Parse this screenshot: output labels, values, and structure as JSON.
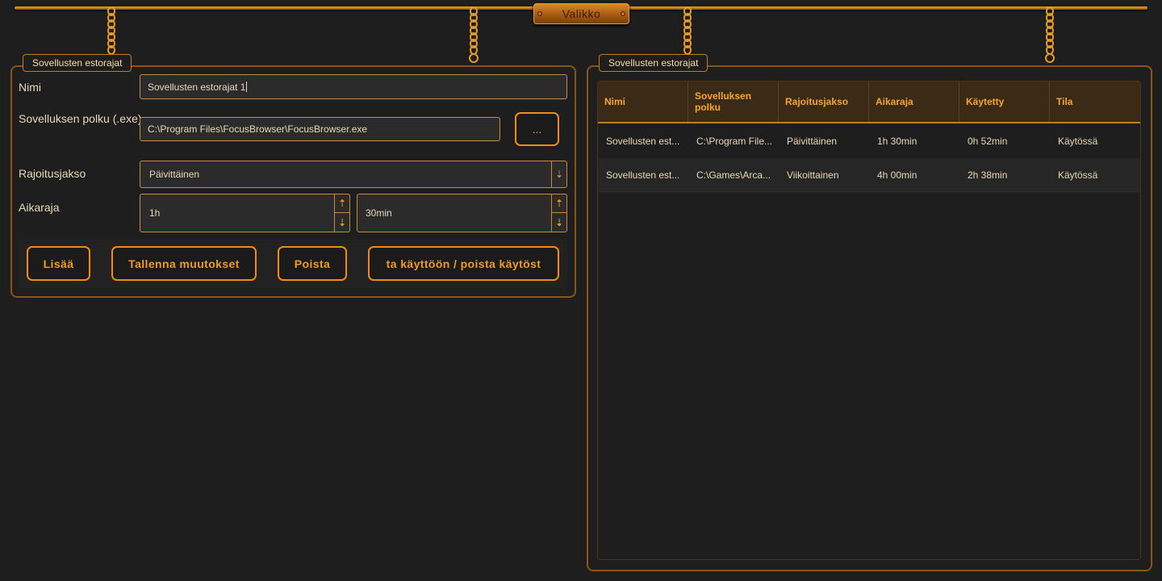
{
  "menu": {
    "label": "Valikko"
  },
  "left_panel": {
    "title": "Sovellusten estorajat",
    "name_label": "Nimi",
    "name_value": "Sovellusten estorajat 1",
    "path_label": "Sovelluksen polku (.exe)",
    "path_value": "C:\\Program Files\\FocusBrowser\\FocusBrowser.exe",
    "browse_label": "...",
    "period_label": "Rajoitusjakso",
    "period_value": "Päivittäinen",
    "limit_label": "Aikaraja",
    "hours_value": "1h",
    "minutes_value": "30min",
    "buttons": {
      "add": "Lisää",
      "save": "Tallenna muutokset",
      "delete": "Poista",
      "toggle": "ta käyttöön / poista käytöst"
    }
  },
  "right_panel": {
    "title": "Sovellusten estorajat",
    "columns": [
      "Nimi",
      "Sovelluksen polku",
      "Rajoitusjakso",
      "Aikaraja",
      "Käytetty",
      "Tila"
    ],
    "rows": [
      [
        "Sovellusten est...",
        "C:\\Program File...",
        "Päivittäinen",
        "1h 30min",
        "0h 52min",
        "Käytössä"
      ],
      [
        "Sovellusten est...",
        "C:\\Games\\Arca...",
        "Viikoittainen",
        "4h 00min",
        "2h 38min",
        "Käytössä"
      ]
    ]
  },
  "icons": {
    "dropdown": "arrow-down-icon",
    "spin_up": "arrow-up-icon",
    "spin_down": "arrow-down-icon"
  },
  "colors": {
    "accent": "#f08c14",
    "panel_border": "#8c5414",
    "background": "#1e1e1e",
    "header_bg": "#3a2a16"
  }
}
